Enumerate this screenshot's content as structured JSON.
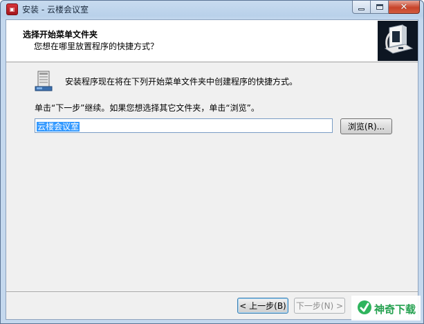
{
  "window": {
    "title": "安装 - 云楼会议室",
    "app_icon": "installer-app-icon"
  },
  "caption_buttons": {
    "minimize": "minimize-icon",
    "maximize": "maximize-icon",
    "close": "close-icon"
  },
  "header": {
    "title": "选择开始菜单文件夹",
    "subtitle": "您想在哪里放置程序的快捷方式？"
  },
  "page": {
    "intro": "安装程序现在将在下列开始菜单文件夹中创建程序的快捷方式。",
    "instruction": "单击“下一步”继续。如果您想选择其它文件夹，单击“浏览”。",
    "folder_value": "云楼会议室",
    "browse_label": "浏览(R)..."
  },
  "footer": {
    "back_label": "< 上一步(B)",
    "next_label": "下一步(N) >"
  },
  "watermark": {
    "text": "神奇下载"
  },
  "colors": {
    "selection": "#3399ff",
    "client_bg": "#f0f0f0",
    "close_red": "#c7432a",
    "watermark_green": "#25a150"
  }
}
